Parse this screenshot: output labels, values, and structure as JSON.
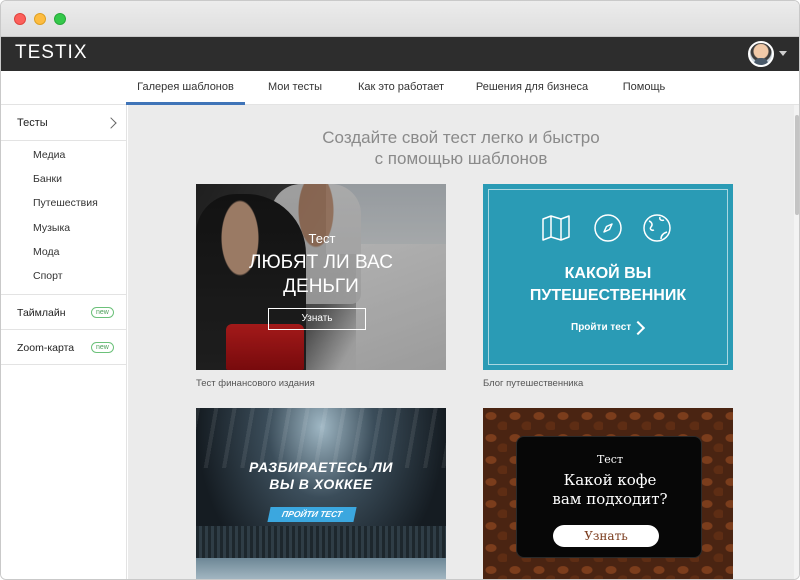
{
  "window": {
    "controls": [
      "close",
      "minimize",
      "zoom"
    ]
  },
  "header": {
    "logo": "TESTIX",
    "avatar": "user-avatar",
    "menu_icon": "chevron-down-icon"
  },
  "tabs": [
    {
      "label": "Галерея шаблонов",
      "active": true
    },
    {
      "label": "Мои тесты",
      "active": false
    },
    {
      "label": "Как это работает",
      "active": false
    },
    {
      "label": "Решения для бизнеса",
      "active": false
    },
    {
      "label": "Помощь",
      "active": false
    }
  ],
  "sidebar": {
    "section_label": "Тесты",
    "section_icon": "chevron-right-icon",
    "subitems": [
      "Медиа",
      "Банки",
      "Путешествия",
      "Музыка",
      "Мода",
      "Спорт"
    ],
    "items": [
      {
        "label": "Таймлайн",
        "badge": "new"
      },
      {
        "label": "Zoom-карта",
        "badge": "new"
      }
    ]
  },
  "main": {
    "headline_line1": "Создайте свой тест легко и быстро",
    "headline_line2": "с помощью шаблонов",
    "cards": [
      {
        "kicker": "Тест",
        "title_line1": "ЛЮБЯТ ЛИ ВАС",
        "title_line2": "ДЕНЬГИ",
        "button": "Узнать",
        "caption": "Тест финансового издания"
      },
      {
        "icons": [
          "map-icon",
          "compass-icon",
          "globe-icon"
        ],
        "title_line1": "КАКОЙ ВЫ",
        "title_line2": "ПУТЕШЕСТВЕННИК",
        "button": "Пройти тест",
        "caption": "Блог путешественника",
        "accent": "#2a9bb5"
      },
      {
        "title_line1": "РАЗБИРАЕТЕСЬ ЛИ",
        "title_line2": "ВЫ В ХОККЕЕ",
        "button": "ПРОЙТИ ТЕСТ",
        "accent": "#3ba7df"
      },
      {
        "kicker": "Тест",
        "title_line1": "Какой кофе",
        "title_line2": "вам подходит?",
        "button": "Узнать"
      }
    ]
  },
  "colors": {
    "appbar": "#2d2d2d",
    "tab_active": "#3f74b8",
    "badge": "#6cc17a",
    "content_bg": "#ebebeb"
  }
}
